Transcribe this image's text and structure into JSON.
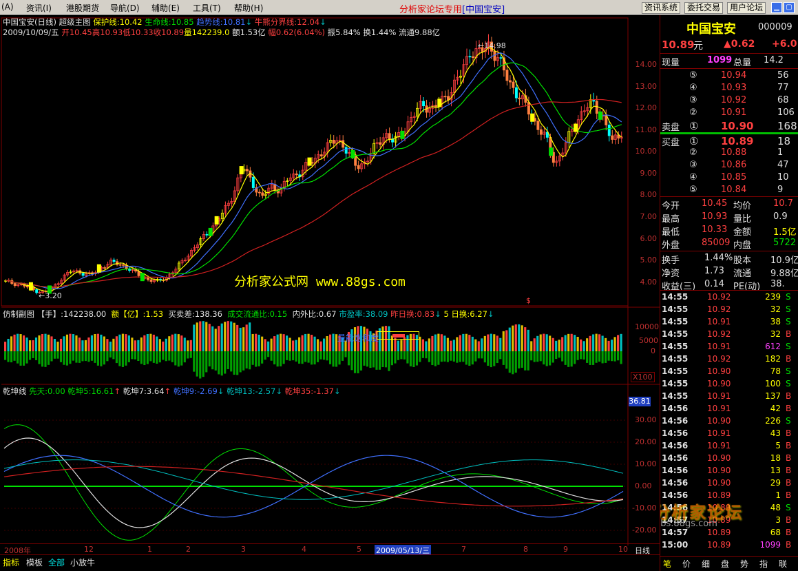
{
  "menu": {
    "items": [
      "(A)",
      "资讯(I)",
      "港股期货",
      "导航(D)",
      "辅助(E)",
      "工具(T)",
      "帮助(H)"
    ],
    "title_prefix": "分析家论坛专用",
    "title_stock": "[中国宝安]",
    "buttons": [
      "资讯系统",
      "委托交易",
      "用户论坛"
    ]
  },
  "chart": {
    "header_name": "中国宝安(日线) 超级主图",
    "ma": [
      {
        "label": "保护线:10.42",
        "color": "#ffff00"
      },
      {
        "label": "生命线:10.85",
        "color": "#00e000"
      },
      {
        "label": "趋势线:10.81",
        "color": "#4070ff"
      },
      {
        "label": "牛熊分界线:12.04",
        "color": "#ff4040"
      }
    ],
    "ohlc_line": {
      "date": "2009/10/09/五",
      "open": "开10.45",
      "high": "高10.93",
      "low": "低10.33",
      "close": "收10.89",
      "vol": "量142239.0",
      "amount": "额1.53亿",
      "change": "幅0.62(6.04%)",
      "amp": "振5.84%",
      "turnover": "换1.44%",
      "float": "流通9.88亿"
    },
    "price_axis": [
      "14.00",
      "13.00",
      "12.00",
      "11.00",
      "10.00",
      "9.00",
      "8.00",
      "7.00",
      "6.00",
      "5.00",
      "4.00"
    ],
    "high_mark": "14.98",
    "low_mark": "3.20",
    "dollar_mark": "$",
    "watermark": "分析家公式网 www.88gs.com"
  },
  "vol_panel": {
    "header": [
      {
        "text": "仿制副图 【手】:142238.00",
        "color": "#e0e0e0"
      },
      {
        "text": "额【亿】:1.53",
        "color": "#ffff00"
      },
      {
        "text": "买卖差:138.36",
        "color": "#e0e0e0"
      },
      {
        "text": "成交流通比:0.15",
        "color": "#00e000"
      },
      {
        "text": "内外比:0.67",
        "color": "#e0e0e0"
      },
      {
        "text": "市盈率:38.09",
        "color": "#00c0c0"
      },
      {
        "text": "昨日换:0.83",
        "color": "#ff4040"
      },
      {
        "text": "5 日换:6.27",
        "color": "#ffff00"
      }
    ],
    "axis": [
      "10000",
      "5000",
      "0"
    ],
    "x100": "X100",
    "saturation_label": "量能饱和度:"
  },
  "osc_panel": {
    "header": [
      {
        "text": "乾坤线",
        "color": "#e0e0e0"
      },
      {
        "text": "先天:0.00",
        "color": "#00e000"
      },
      {
        "text": "乾坤5:16.61",
        "color": "#00e000"
      },
      {
        "text": "乾坤7:3.64",
        "color": "#e0e0e0"
      },
      {
        "text": "乾坤9:-2.69",
        "color": "#4070ff"
      },
      {
        "text": "乾坤13:-2.57",
        "color": "#00c0c0"
      },
      {
        "text": "乾坤35:-1.37",
        "color": "#ff4040"
      }
    ],
    "axis": [
      "30.00",
      "20.00",
      "10.00",
      "0.00",
      "-10.00",
      "-20.00"
    ],
    "current_value": "36.81"
  },
  "time_axis": {
    "labels": [
      "2008年",
      "12",
      "1",
      "2",
      "3",
      "4",
      "5",
      "2009/05/13/三",
      "7",
      "8",
      "9",
      "10"
    ],
    "period": "日线"
  },
  "bottom_tabs": [
    "指标",
    "模板",
    "全部",
    "小放牛"
  ],
  "quote": {
    "name": "中国宝安",
    "code": "000009",
    "price": "10.89",
    "unit": "元",
    "change": "▲0.62",
    "change_pct": "+6.0",
    "now_vol_label": "现量",
    "now_vol": "1099",
    "total_vol_label": "总量",
    "total_vol": "14.2",
    "sell_label": "卖盘",
    "buy_label": "买盘",
    "sells": [
      {
        "lv": "⑤",
        "price": "10.94",
        "vol": "56"
      },
      {
        "lv": "④",
        "price": "10.93",
        "vol": "77"
      },
      {
        "lv": "③",
        "price": "10.92",
        "vol": "68"
      },
      {
        "lv": "②",
        "price": "10.91",
        "vol": "106"
      },
      {
        "lv": "①",
        "price": "10.90",
        "vol": "168"
      }
    ],
    "buys": [
      {
        "lv": "①",
        "price": "10.89",
        "vol": "18"
      },
      {
        "lv": "②",
        "price": "10.88",
        "vol": "1"
      },
      {
        "lv": "③",
        "price": "10.86",
        "vol": "47"
      },
      {
        "lv": "④",
        "price": "10.85",
        "vol": "10"
      },
      {
        "lv": "⑤",
        "price": "10.84",
        "vol": "9"
      }
    ],
    "stats": [
      {
        "l1": "今开",
        "v1": "10.45",
        "c1": "#ff4040",
        "l2": "均价",
        "v2": "10.7",
        "c2": "#ff4040"
      },
      {
        "l1": "最高",
        "v1": "10.93",
        "c1": "#ff4040",
        "l2": "量比",
        "v2": "0.9",
        "c2": "#e0e0e0"
      },
      {
        "l1": "最低",
        "v1": "10.33",
        "c1": "#ff4040",
        "l2": "金额",
        "v2": "1.5亿",
        "c2": "#ffff00"
      },
      {
        "l1": "外盘",
        "v1": "85009",
        "c1": "#ff4040",
        "l2": "内盘",
        "v2": "5722",
        "c2": "#00e000"
      }
    ],
    "stats2": [
      {
        "l1": "换手",
        "v1": "1.44%",
        "l2": "股本",
        "v2": "10.9亿"
      },
      {
        "l1": "净资",
        "v1": "1.73",
        "l2": "流通",
        "v2": "9.88亿"
      },
      {
        "l1": "收益(三)",
        "v1": "0.14",
        "l2": "PE(动)",
        "v2": "38."
      }
    ],
    "ticks": [
      {
        "t": "14:55",
        "p": "10.92",
        "v": "239",
        "s": "S"
      },
      {
        "t": "14:55",
        "p": "10.92",
        "v": "32",
        "s": "S"
      },
      {
        "t": "14:55",
        "p": "10.91",
        "v": "38",
        "s": "S"
      },
      {
        "t": "14:55",
        "p": "10.92",
        "v": "32",
        "s": "B"
      },
      {
        "t": "14:55",
        "p": "10.91",
        "v": "612",
        "s": "S"
      },
      {
        "t": "14:55",
        "p": "10.92",
        "v": "182",
        "s": "B"
      },
      {
        "t": "14:55",
        "p": "10.90",
        "v": "78",
        "s": "S"
      },
      {
        "t": "14:55",
        "p": "10.90",
        "v": "100",
        "s": "S"
      },
      {
        "t": "14:55",
        "p": "10.91",
        "v": "137",
        "s": "B"
      },
      {
        "t": "14:56",
        "p": "10.91",
        "v": "42",
        "s": "B"
      },
      {
        "t": "14:56",
        "p": "10.90",
        "v": "226",
        "s": "S"
      },
      {
        "t": "14:56",
        "p": "10.91",
        "v": "43",
        "s": "B"
      },
      {
        "t": "14:56",
        "p": "10.91",
        "v": "5",
        "s": "B"
      },
      {
        "t": "14:56",
        "p": "10.90",
        "v": "18",
        "s": "B"
      },
      {
        "t": "14:56",
        "p": "10.90",
        "v": "13",
        "s": "B"
      },
      {
        "t": "14:56",
        "p": "10.90",
        "v": "29",
        "s": "B"
      },
      {
        "t": "14:56",
        "p": "10.89",
        "v": "1",
        "s": "B"
      },
      {
        "t": "14:56",
        "p": "10.89",
        "v": "48",
        "s": "S"
      },
      {
        "t": "14:57",
        "p": "10.89",
        "v": "3",
        "s": "B"
      },
      {
        "t": "14:57",
        "p": "10.89",
        "v": "68",
        "s": "B"
      },
      {
        "t": "15:00",
        "p": "10.89",
        "v": "1099",
        "s": "B"
      }
    ],
    "bottom_tabs": [
      "笔",
      "价",
      "细",
      "盘",
      "势",
      "指",
      "联"
    ],
    "forum_watermark": "分析家论坛",
    "forum_sub": "bbs.88gs.com"
  },
  "chart_data": {
    "type": "candlestick",
    "x_labels": [
      "2008年",
      "12",
      "1",
      "2",
      "3",
      "4",
      "5",
      "2009/05/13/三",
      "7",
      "8",
      "9",
      "10"
    ],
    "price_ylim": [
      3.2,
      14.98
    ],
    "price_ticks": [
      4,
      5,
      6,
      7,
      8,
      9,
      10,
      11,
      12,
      13,
      14
    ],
    "last_close": 10.89,
    "high": 14.98,
    "low": 3.2,
    "close_path": [
      4.0,
      3.9,
      3.8,
      3.6,
      3.5,
      3.7,
      4.2,
      4.5,
      4.4,
      4.3,
      4.6,
      4.9,
      4.8,
      4.6,
      4.3,
      4.1,
      4.0,
      4.2,
      4.6,
      5.1,
      5.6,
      6.1,
      6.6,
      7.2,
      8.0,
      9.3,
      8.6,
      7.8,
      8.4,
      8.2,
      8.8,
      9.0,
      9.4,
      9.8,
      10.2,
      10.6,
      10.0,
      9.3,
      9.5,
      10.2,
      10.8,
      10.4,
      11.0,
      11.6,
      12.2,
      11.9,
      12.3,
      12.8,
      13.5,
      14.6,
      14.5,
      14.9,
      14.2,
      13.3,
      12.6,
      12.0,
      11.2,
      10.6,
      9.4,
      10.2,
      11.2,
      11.9,
      12.2,
      11.6,
      10.4,
      10.89
    ],
    "vol_ylim": [
      -5000,
      12000
    ],
    "osc_ylim": [
      -25,
      40
    ],
    "osc_ticks": [
      -20,
      -10,
      0,
      10,
      20,
      30
    ]
  }
}
